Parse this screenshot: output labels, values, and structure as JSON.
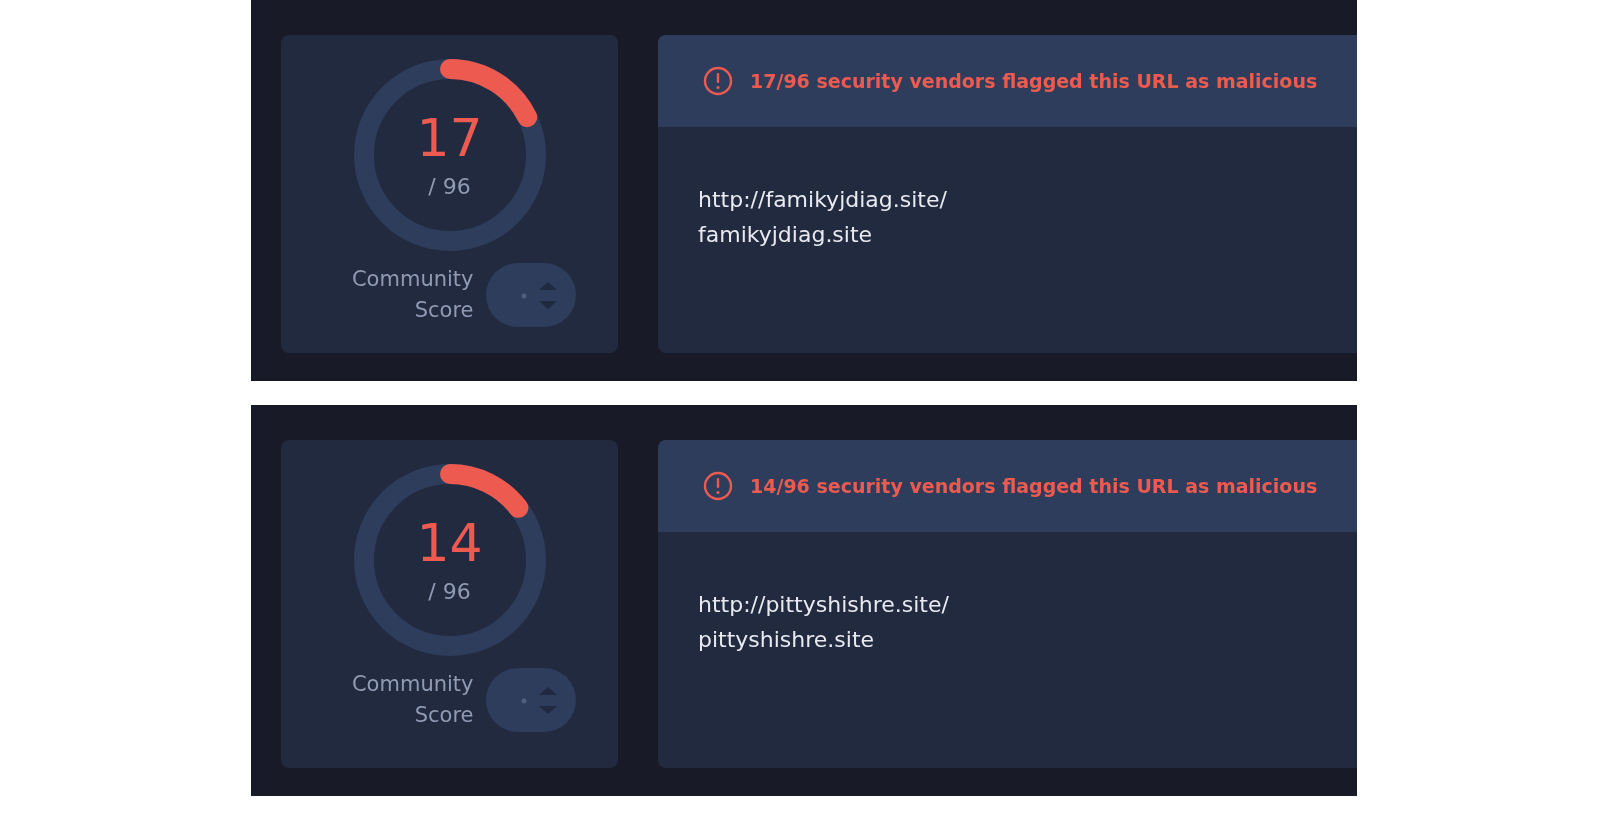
{
  "reports": [
    {
      "score": "17",
      "total": "/ 96",
      "level": 0.177,
      "score_label": "Community Score",
      "alert": "17/96 security vendors flagged this URL as malicious",
      "url": "http://famikyjdiag.site/",
      "domain": "famikyjdiag.site"
    },
    {
      "score": "14",
      "total": "/ 96",
      "level": 0.146,
      "score_label": "Community Score",
      "alert": "14/96 security vendors flagged this URL as malicious",
      "url": "http://pittyshishre.site/",
      "domain": "pittyshishre.site"
    }
  ]
}
